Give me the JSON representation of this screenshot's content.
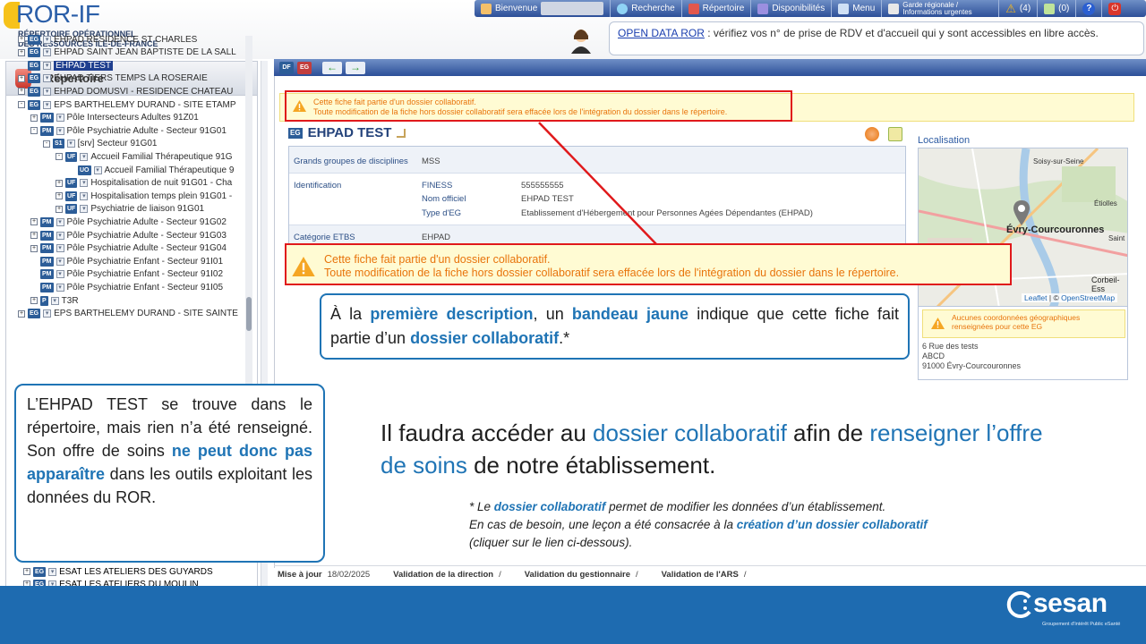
{
  "header": {
    "logo_title": "ROR-IF",
    "logo_sub_line1": "RÉPERTOIRE OPÉRATIONNEL",
    "logo_sub_line2": "DES RESSOURCES ÎLE-DE-FRANCE",
    "nav": [
      {
        "label": "Bienvenue",
        "icon": "user-icon"
      },
      {
        "label": "Recherche",
        "icon": "search-icon"
      },
      {
        "label": "Répertoire",
        "icon": "book-icon"
      },
      {
        "label": "Disponibilités",
        "icon": "calendar-icon"
      },
      {
        "label": "Menu",
        "icon": "monitor-icon"
      },
      {
        "label": "Garde régionale / Informations urgentes",
        "icon": "document-icon"
      },
      {
        "label": "(4)",
        "icon": "warning-icon"
      },
      {
        "label": "(0)",
        "icon": "mail-icon"
      },
      {
        "label": "?",
        "icon": "help-icon"
      },
      {
        "label": "",
        "icon": "power-icon"
      }
    ],
    "notice_link": "OPEN DATA ROR",
    "notice_text": " : vérifiez vos n° de prise de RDV et d'accueil qui y sont accessibles en libre accès."
  },
  "sidebar": {
    "title": "Répertoire",
    "items": [
      {
        "tag": "EG",
        "label": "EHPAD RESIDENCE ST CHARLES",
        "indent": 0,
        "exp": "+"
      },
      {
        "tag": "EG",
        "label": "EHPAD SAINT JEAN BAPTISTE DE LA SALL",
        "indent": 0,
        "exp": "+"
      },
      {
        "tag": "EG",
        "label": "EHPAD TEST",
        "indent": 0,
        "exp": "",
        "selected": true
      },
      {
        "tag": "EG",
        "label": "EHPAD TIERS TEMPS LA ROSERAIE",
        "indent": 0,
        "exp": "+"
      },
      {
        "tag": "EG",
        "label": "EHPAD DOMUSVI - RESIDENCE CHATEAU",
        "indent": 0,
        "exp": "+"
      },
      {
        "tag": "EG",
        "label": "EPS BARTHELEMY DURAND - SITE ETAMP",
        "indent": 0,
        "exp": "-"
      },
      {
        "tag": "PM",
        "label": "Pôle Intersecteurs Adultes 91Z01",
        "indent": 1,
        "exp": "+"
      },
      {
        "tag": "PM",
        "label": "Pôle Psychiatrie Adulte - Secteur 91G01",
        "indent": 1,
        "exp": "-"
      },
      {
        "tag": "S1",
        "label": "[srv] Secteur 91G01",
        "indent": 2,
        "exp": "-"
      },
      {
        "tag": "UF",
        "label": "Accueil Familial Thérapeutique 91G",
        "indent": 3,
        "exp": "-"
      },
      {
        "tag": "UO",
        "label": "Accueil Familial Thérapeutique 9",
        "indent": 4,
        "exp": ""
      },
      {
        "tag": "UF",
        "label": "Hospitalisation de nuit 91G01 - Cha",
        "indent": 3,
        "exp": "+"
      },
      {
        "tag": "UF",
        "label": "Hospitalisation temps plein 91G01 -",
        "indent": 3,
        "exp": "+"
      },
      {
        "tag": "UF",
        "label": "Psychiatrie de liaison 91G01",
        "indent": 3,
        "exp": "+"
      },
      {
        "tag": "PM",
        "label": "Pôle Psychiatrie Adulte - Secteur 91G02",
        "indent": 1,
        "exp": "+"
      },
      {
        "tag": "PM",
        "label": "Pôle Psychiatrie Adulte - Secteur 91G03",
        "indent": 1,
        "exp": "+"
      },
      {
        "tag": "PM",
        "label": "Pôle Psychiatrie Adulte - Secteur 91G04",
        "indent": 1,
        "exp": "+"
      },
      {
        "tag": "PM",
        "label": "Pôle Psychiatrie Enfant - Secteur 91I01",
        "indent": 1,
        "exp": ""
      },
      {
        "tag": "PM",
        "label": "Pôle Psychiatrie Enfant - Secteur 91I02",
        "indent": 1,
        "exp": ""
      },
      {
        "tag": "PM",
        "label": "Pôle Psychiatrie Enfant - Secteur 91I05",
        "indent": 1,
        "exp": ""
      },
      {
        "tag": "P",
        "label": "T3R",
        "indent": 1,
        "exp": "+"
      },
      {
        "tag": "EG",
        "label": "EPS BARTHELEMY DURAND - SITE SAINTE",
        "indent": 0,
        "exp": "+"
      }
    ],
    "bottom_items": [
      {
        "tag": "EG",
        "label": "ESAT LES ATELIERS DES GUYARDS"
      },
      {
        "tag": "EG",
        "label": "ESAT LES ATELIERS DU MOULIN"
      }
    ]
  },
  "toolbar": {
    "df": "DF",
    "eg": "EG",
    "back": "←",
    "forward": "→"
  },
  "fiche": {
    "banner_line1": "Cette fiche fait partie d'un dossier collaboratif.",
    "banner_line2": "Toute modification de la fiche hors dossier collaboratif sera effacée lors de l'intégration du dossier dans le répertoire.",
    "tag": "EG",
    "name": "EHPAD TEST",
    "rows": {
      "ggd_label": "Grands groupes de disciplines",
      "ggd_value": "MSS",
      "ident_label": "Identification",
      "finess_label": "FINESS",
      "finess_value": "555555555",
      "nom_label": "Nom officiel",
      "nom_value": "EHPAD TEST",
      "type_label": "Type d'EG",
      "type_value": "Etablissement d'Hébergement pour Personnes Agées Dépendantes (EHPAD)",
      "cat_label": "Catégorie ETBS",
      "cat_value": "EHPAD"
    }
  },
  "localisation": {
    "title": "Localisation",
    "map_labels": {
      "soisy": "Soisy-sur-Seine",
      "etiolles": "Étiolles",
      "evry": "Évry-Courcouronnes",
      "saint": "Saint",
      "corbeil": "Corbeil-Ess"
    },
    "credit_leaflet": "Leaflet",
    "credit_sep": " | © ",
    "credit_osm": "OpenStreetMap",
    "geo_warning": "Aucunes coordonnées géographiques renseignées pour cette EG",
    "addr1": "6 Rue des tests",
    "addr2": "ABCD",
    "addr3": "91000 Évry-Courcouronnes"
  },
  "callout1": {
    "p1": "À la ",
    "h1": "première description",
    "p2": ", un ",
    "h2": "bandeau jaune",
    "p3": " indique que cette fiche fait partie d’un ",
    "h3": "dossier collaboratif",
    "p4": ".*"
  },
  "callout2": {
    "p1": "L’EHPAD TEST se trouve dans le répertoire, mais rien n’a été renseigné. Son offre de soins ",
    "h1": "ne peut donc pas apparaître",
    "p2": " dans les outils exploitant les données du ROR."
  },
  "main_text": {
    "p1": "Il faudra accéder au ",
    "h1": "dossier collaboratif",
    "p2": " afin de ",
    "h2": "renseigner l’offre de soins",
    "p3": " de notre établissement."
  },
  "footnote": {
    "p1": "* Le ",
    "h1": "dossier collaboratif",
    "p2": " permet de modifier les données d’un établissement.",
    "p3": "En cas de besoin, une leçon a été consacrée à la ",
    "h2": "création d’un dossier collaboratif",
    "p4": "(cliquer sur le lien ci-dessous)."
  },
  "statusbar": {
    "maj_label": "Mise à jour",
    "maj_value": "18/02/2025",
    "direction": "Validation de la direction",
    "gestionnaire": "Validation du gestionnaire",
    "ars": "Validation de l'ARS",
    "sep": "/"
  },
  "footer": {
    "brand": "sesan",
    "brand_sub": "Groupement d'Intérêt Public eSanté"
  },
  "colors": {
    "accent_blue": "#1f74b5",
    "warning_orange": "#e8740c",
    "highlight_red": "#e0191b",
    "banner_yellow": "#fffbd3"
  }
}
